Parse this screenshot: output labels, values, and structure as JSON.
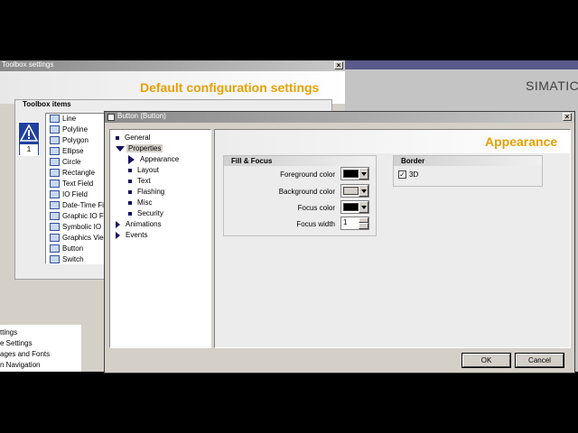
{
  "toolbox_window": {
    "title": "Toolbox settings",
    "heading": "Default configuration settings",
    "section_label": "Toolbox items",
    "items": [
      {
        "label": "Line",
        "icon": "line-icon"
      },
      {
        "label": "Polyline",
        "icon": "polyline-icon"
      },
      {
        "label": "Polygon",
        "icon": "polygon-icon"
      },
      {
        "label": "Ellipse",
        "icon": "ellipse-icon"
      },
      {
        "label": "Circle",
        "icon": "circle-icon"
      },
      {
        "label": "Rectangle",
        "icon": "rectangle-icon"
      },
      {
        "label": "Text Field",
        "icon": "text-field-icon"
      },
      {
        "label": "IO Field",
        "icon": "io-field-icon"
      },
      {
        "label": "Date-Time Fi",
        "icon": "date-time-field-icon"
      },
      {
        "label": "Graphic IO F",
        "icon": "graphic-io-field-icon"
      },
      {
        "label": "Symbolic IO",
        "icon": "symbolic-io-icon"
      },
      {
        "label": "Graphics Vie",
        "icon": "graphics-view-icon"
      },
      {
        "label": "Button",
        "icon": "button-icon"
      },
      {
        "label": "Switch",
        "icon": "switch-icon"
      }
    ]
  },
  "left_tree": {
    "items": [
      "ttings",
      "e Settings",
      "ages and Fonts",
      "n Navigation"
    ]
  },
  "brand": "SIMATIC",
  "dialog": {
    "title": "Button (Button)",
    "heading": "Appearance",
    "nav": [
      {
        "label": "General",
        "marker": "square",
        "indent": 0
      },
      {
        "label": "Properties",
        "marker": "expanded",
        "indent": 0,
        "selected": true
      },
      {
        "label": "Appearance",
        "marker": "arrow",
        "indent": 1
      },
      {
        "label": "Layout",
        "marker": "square",
        "indent": 1
      },
      {
        "label": "Text",
        "marker": "square",
        "indent": 1
      },
      {
        "label": "Flashing",
        "marker": "square",
        "indent": 1
      },
      {
        "label": "Misc",
        "marker": "square",
        "indent": 1
      },
      {
        "label": "Security",
        "marker": "square",
        "indent": 1
      },
      {
        "label": "Animations",
        "marker": "collapsed",
        "indent": 0
      },
      {
        "label": "Events",
        "marker": "collapsed",
        "indent": 0
      }
    ],
    "fill_focus": {
      "title": "Fill & Focus",
      "foreground_label": "Foreground color",
      "foreground_color": "#000000",
      "background_label": "Background color",
      "background_color": "#d4d0c8",
      "focus_color_label": "Focus color",
      "focus_color": "#000000",
      "focus_width_label": "Focus width",
      "focus_width_value": "1"
    },
    "border": {
      "title": "Border",
      "checkbox_label": "3D",
      "checked": true
    },
    "ok_label": "OK",
    "cancel_label": "Cancel"
  },
  "colors": {
    "accent_heading": "#e8a000",
    "nav_marker": "#101060"
  }
}
